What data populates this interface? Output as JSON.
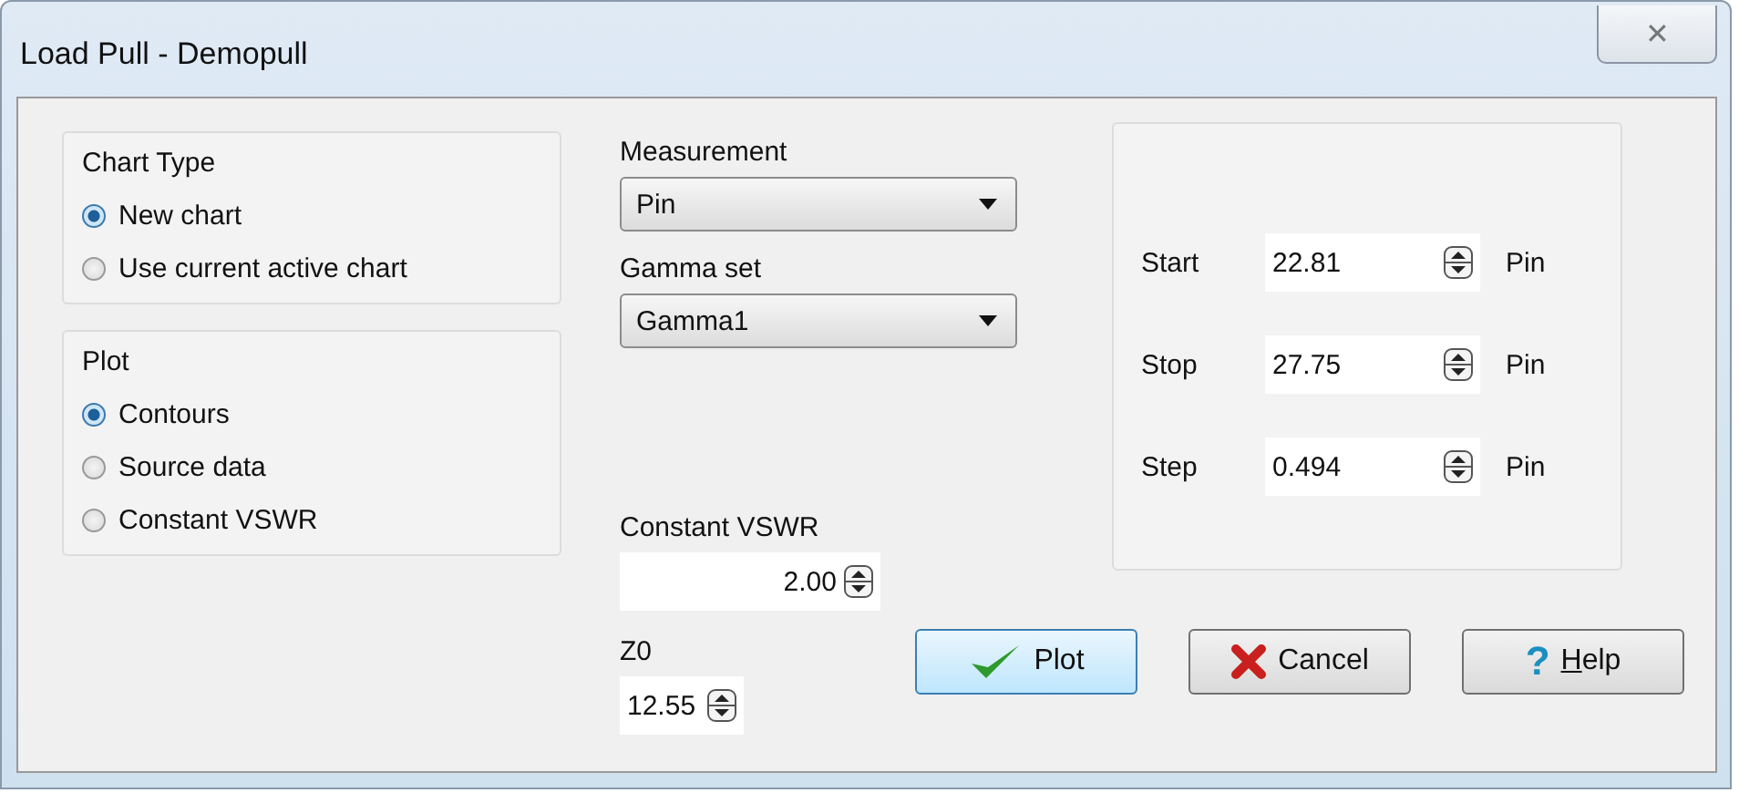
{
  "window": {
    "title": "Load Pull - Demopull",
    "close": "✕"
  },
  "chart_type": {
    "title": "Chart Type",
    "options": [
      {
        "label": "New chart",
        "selected": true
      },
      {
        "label": "Use current active chart",
        "selected": false
      }
    ]
  },
  "plot": {
    "title": "Plot",
    "options": [
      {
        "label": "Contours",
        "selected": true
      },
      {
        "label": "Source data",
        "selected": false
      },
      {
        "label": "Constant VSWR",
        "selected": false
      }
    ]
  },
  "measurement": {
    "label": "Measurement",
    "value": "Pin"
  },
  "gamma_set": {
    "label": "Gamma set",
    "value": "Gamma1"
  },
  "constant_vswr": {
    "label": "Constant VSWR",
    "value": "2.00"
  },
  "z0": {
    "label": "Z0",
    "value": "12.55"
  },
  "range": [
    {
      "label": "Start",
      "value": "22.81",
      "unit": "Pin"
    },
    {
      "label": "Stop",
      "value": "27.75",
      "unit": "Pin"
    },
    {
      "label": "Step",
      "value": "0.494",
      "unit": "Pin"
    }
  ],
  "buttons": [
    {
      "kind": "ok",
      "label": "Plot",
      "focused": true
    },
    {
      "kind": "cancel",
      "label": "Cancel",
      "focused": false
    },
    {
      "kind": "help",
      "label": "Help",
      "icon": "?",
      "focused": false
    }
  ]
}
